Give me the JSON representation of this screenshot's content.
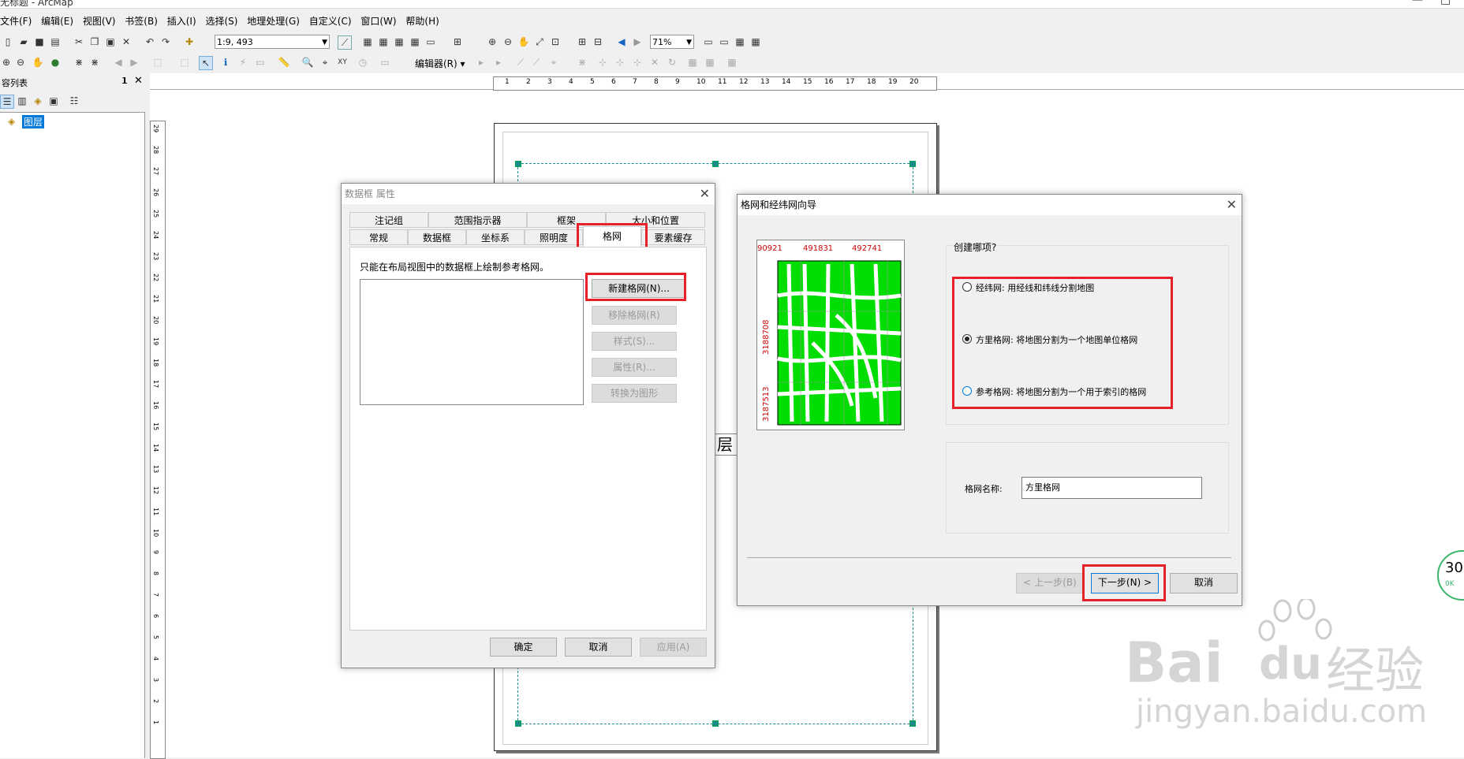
{
  "app": {
    "title": "无标题 - ArcMap"
  },
  "menu": [
    "文件(F)",
    "编辑(E)",
    "视图(V)",
    "书签(B)",
    "插入(I)",
    "选择(S)",
    "地理处理(G)",
    "自定义(C)",
    "窗口(W)",
    "帮助(H)"
  ],
  "toolbar": {
    "scale": "1:9, 493",
    "zoom": "71%",
    "editor": "编辑器(R)"
  },
  "toc": {
    "title": "容列表",
    "layer": "图层"
  },
  "ruler": {
    "h": [
      "1",
      "2",
      "3",
      "4",
      "5",
      "6",
      "7",
      "8",
      "9",
      "10",
      "11",
      "12",
      "13",
      "14",
      "15",
      "16",
      "17",
      "18",
      "19",
      "20"
    ],
    "v": [
      "29",
      "28",
      "27",
      "26",
      "25",
      "24",
      "23",
      "22",
      "21",
      "20",
      "19",
      "18",
      "17",
      "16",
      "15",
      "14",
      "13",
      "12",
      "11",
      "10",
      "9",
      "8",
      "7",
      "6",
      "5",
      "4",
      "3",
      "2",
      "1"
    ]
  },
  "map_text": "层",
  "dialog1": {
    "title": "数据框 属性",
    "tabs_row1": [
      "注记组",
      "范围指示器",
      "框架",
      "大小和位置"
    ],
    "tabs_row2": [
      "常规",
      "数据框",
      "坐标系",
      "照明度",
      "格网",
      "要素缓存"
    ],
    "info": "只能在布局视图中的数据框上绘制参考格网。",
    "buttons": {
      "new": "新建格网(N)...",
      "remove": "移除格网(R)",
      "style": "样式(S)...",
      "props": "属性(R)...",
      "convert": "转换为图形"
    },
    "footer": {
      "ok": "确定",
      "cancel": "取消",
      "apply": "应用(A)"
    }
  },
  "dialog2": {
    "title": "格网和经纬网向导",
    "preview": {
      "top_labels": [
        "90921",
        "491831",
        "492741"
      ],
      "side_labels": [
        "3188708",
        "3187513"
      ]
    },
    "question": "创建哪项?",
    "options": [
      "经纬网: 用经线和纬线分割地图",
      "方里格网: 将地图分割为一个地图单位格网",
      "参考格网: 将地图分割为一个用于索引的格网"
    ],
    "name_label": "格网名称:",
    "name_value": "方里格网",
    "footer": {
      "back": "< 上一步(B)",
      "next": "下一步(N) >",
      "cancel": "取消"
    }
  },
  "widget": {
    "value": "30",
    "speed": "0K"
  },
  "watermark": {
    "brand": "Bai",
    "brand2": "du",
    "cn": "经验",
    "url": "jingyan.baidu.com"
  }
}
